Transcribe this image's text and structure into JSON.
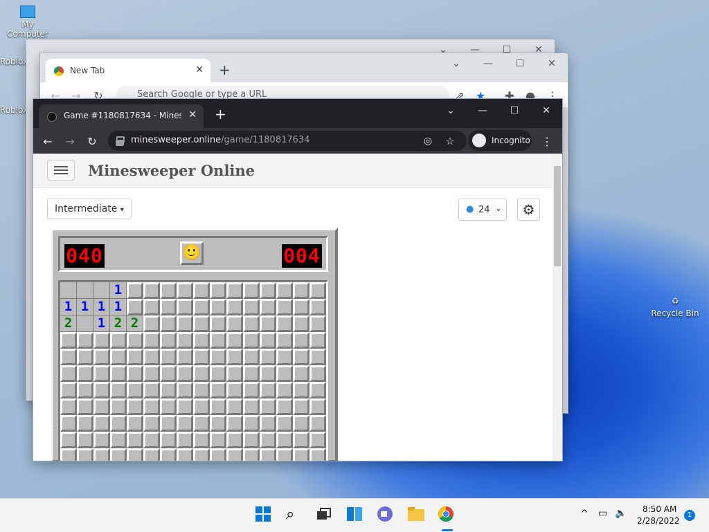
{
  "desktop": {
    "icons": [
      {
        "label": "My Computer"
      },
      {
        "label": "Roblox"
      },
      {
        "label": "Roblox"
      },
      {
        "label": "Recycle Bin"
      }
    ]
  },
  "back_window": {
    "controls": [
      "⌄",
      "—",
      "☐",
      "✕"
    ]
  },
  "mid_window": {
    "tab_title": "New Tab",
    "omnibox_placeholder": "Search Google or type a URL"
  },
  "front_window": {
    "tab_title": "Game #1180817634 - Minesweeper",
    "url_domain": "minesweeper.online",
    "url_path": "/game/1180817634",
    "profile": "Incognito"
  },
  "page": {
    "site_title": "Minesweeper Online",
    "level": "Intermediate",
    "zoom_value": "24"
  },
  "game": {
    "mines_counter": "040",
    "timer": "004",
    "face": "🙂",
    "board": [
      [
        "o",
        "o",
        "o",
        "1",
        "c",
        "c",
        "c",
        "c",
        "c",
        "c",
        "c",
        "c",
        "c",
        "c",
        "c",
        "c"
      ],
      [
        "1",
        "1",
        "1",
        "1",
        "c",
        "c",
        "c",
        "c",
        "c",
        "c",
        "c",
        "c",
        "c",
        "c",
        "c",
        "c"
      ],
      [
        "2",
        "o",
        "1",
        "2",
        "2",
        "c",
        "c",
        "c",
        "c",
        "c",
        "c",
        "c",
        "c",
        "c",
        "c",
        "c"
      ],
      [
        "c",
        "c",
        "c",
        "c",
        "c",
        "c",
        "c",
        "c",
        "c",
        "c",
        "c",
        "c",
        "c",
        "c",
        "c",
        "c"
      ],
      [
        "c",
        "c",
        "c",
        "c",
        "c",
        "c",
        "c",
        "c",
        "c",
        "c",
        "c",
        "c",
        "c",
        "c",
        "c",
        "c"
      ],
      [
        "c",
        "c",
        "c",
        "c",
        "c",
        "c",
        "c",
        "c",
        "c",
        "c",
        "c",
        "c",
        "c",
        "c",
        "c",
        "c"
      ],
      [
        "c",
        "c",
        "c",
        "c",
        "c",
        "c",
        "c",
        "c",
        "c",
        "c",
        "c",
        "c",
        "c",
        "c",
        "c",
        "c"
      ],
      [
        "c",
        "c",
        "c",
        "c",
        "c",
        "c",
        "c",
        "c",
        "c",
        "c",
        "c",
        "c",
        "c",
        "c",
        "c",
        "c"
      ],
      [
        "c",
        "c",
        "c",
        "c",
        "c",
        "c",
        "c",
        "c",
        "c",
        "c",
        "c",
        "c",
        "c",
        "c",
        "c",
        "c"
      ],
      [
        "c",
        "c",
        "c",
        "c",
        "c",
        "c",
        "c",
        "c",
        "c",
        "c",
        "c",
        "c",
        "c",
        "c",
        "c",
        "c"
      ],
      [
        "c",
        "c",
        "c",
        "c",
        "c",
        "c",
        "c",
        "c",
        "c",
        "c",
        "c",
        "c",
        "c",
        "c",
        "c",
        "c"
      ]
    ]
  },
  "taskbar": {
    "time": "8:50 AM",
    "date": "2/28/2022",
    "notifications": "1"
  }
}
